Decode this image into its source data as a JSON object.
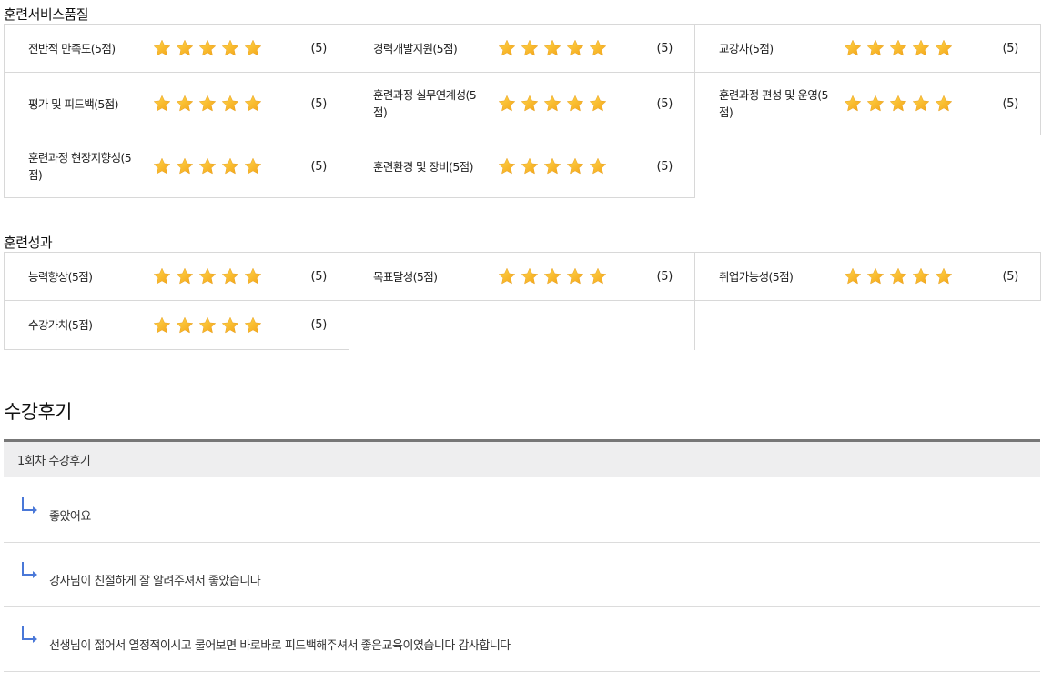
{
  "colors": {
    "star_light": "#ffd64a",
    "star_dark": "#f3a317",
    "arrow": "#4a78d8",
    "border": "#d8d8d8"
  },
  "service_quality": {
    "title": "훈련서비스품질",
    "rows": [
      [
        {
          "label": "전반적 만족도(5점)",
          "stars": 5,
          "score": "(5)"
        },
        {
          "label": "경력개발지원(5점)",
          "stars": 5,
          "score": "(5)"
        },
        {
          "label": "교강사(5점)",
          "stars": 5,
          "score": "(5)"
        }
      ],
      [
        {
          "label": "평가 및 피드백(5점)",
          "stars": 5,
          "score": "(5)"
        },
        {
          "label": "훈련과정 실무연계성(5점)",
          "stars": 5,
          "score": "(5)"
        },
        {
          "label": "훈련과정 편성 및 운영(5점)",
          "stars": 5,
          "score": "(5)"
        }
      ],
      [
        {
          "label": "훈련과정 현장지향성(5점)",
          "stars": 5,
          "score": "(5)"
        },
        {
          "label": "훈련환경 및 장비(5점)",
          "stars": 5,
          "score": "(5)"
        }
      ]
    ]
  },
  "training_outcome": {
    "title": "훈련성과",
    "rows": [
      [
        {
          "label": "능력향상(5점)",
          "stars": 5,
          "score": "(5)"
        },
        {
          "label": "목표달성(5점)",
          "stars": 5,
          "score": "(5)"
        },
        {
          "label": "취업가능성(5점)",
          "stars": 5,
          "score": "(5)"
        }
      ],
      [
        {
          "label": "수강가치(5점)",
          "stars": 5,
          "score": "(5)"
        }
      ]
    ]
  },
  "reviews": {
    "title": "수강후기",
    "session_header": "1회차 수강후기",
    "items": [
      {
        "text": "좋았어요"
      },
      {
        "text": "강사님이 친절하게 잘 알려주셔서 좋았습니다"
      },
      {
        "text": "선생님이 젊어서 열정적이시고 물어보면 바로바로 피드백해주셔서 좋은교육이였습니다 감사합니다"
      }
    ]
  }
}
